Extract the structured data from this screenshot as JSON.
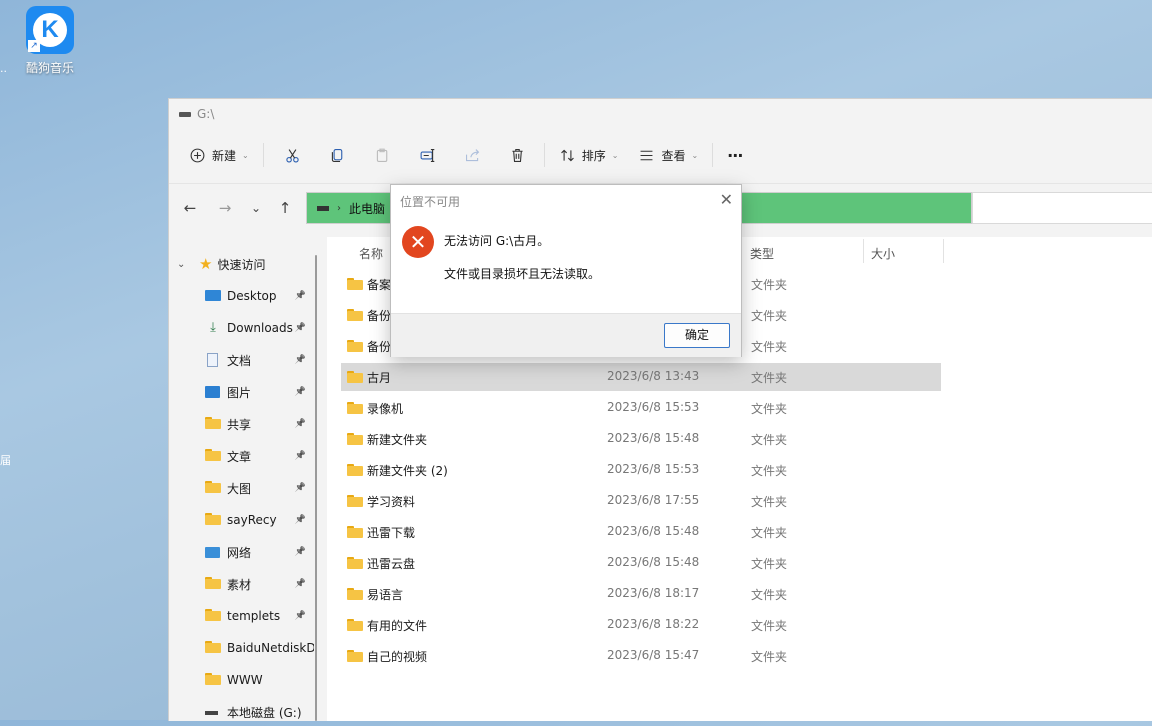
{
  "desktop": {
    "icon_label": "酷狗音乐",
    "icon_letter": "K",
    "edge_dots": "..",
    "edge_char": "届"
  },
  "window": {
    "title": "G:\\",
    "toolbar": {
      "new_label": "新建",
      "sort_label": "排序",
      "view_label": "查看",
      "more_label": "···"
    },
    "nav": {
      "back": "←",
      "forward": "→",
      "recent": "⌄",
      "up": "↑"
    },
    "address": {
      "crumb": "此电脑"
    },
    "sidebar": {
      "quick_access": "快速访问",
      "items": [
        {
          "label": "Desktop",
          "icon": "desktop-icon",
          "pinned": true
        },
        {
          "label": "Downloads",
          "icon": "download-icon",
          "pinned": true
        },
        {
          "label": "文档",
          "icon": "document-icon",
          "pinned": true
        },
        {
          "label": "图片",
          "icon": "picture-icon",
          "pinned": true
        },
        {
          "label": "共享",
          "icon": "folder-icon",
          "pinned": true
        },
        {
          "label": "文章",
          "icon": "folder-icon",
          "pinned": true
        },
        {
          "label": "大图",
          "icon": "folder-icon",
          "pinned": true
        },
        {
          "label": "sayRecy",
          "icon": "folder-icon",
          "pinned": true
        },
        {
          "label": "网络",
          "icon": "network-icon",
          "pinned": true
        },
        {
          "label": "素材",
          "icon": "folder-icon",
          "pinned": true
        },
        {
          "label": "templets",
          "icon": "folder-icon",
          "pinned": true
        },
        {
          "label": "BaiduNetdiskD",
          "icon": "folder-icon",
          "pinned": false
        },
        {
          "label": "WWW",
          "icon": "folder-icon",
          "pinned": false
        },
        {
          "label": "本地磁盘 (G:)",
          "icon": "drive-icon",
          "pinned": false
        }
      ]
    },
    "columns": {
      "name": "名称",
      "type": "类型",
      "size": "大小"
    },
    "files": [
      {
        "name": "备案",
        "date": "",
        "type": "文件夹"
      },
      {
        "name": "备份",
        "date": "",
        "type": "文件夹"
      },
      {
        "name": "备份",
        "date": "",
        "type": "文件夹"
      },
      {
        "name": "古月",
        "date": "2023/6/8 13:43",
        "type": "文件夹",
        "selected": true
      },
      {
        "name": "录像机",
        "date": "2023/6/8 15:53",
        "type": "文件夹"
      },
      {
        "name": "新建文件夹",
        "date": "2023/6/8 15:48",
        "type": "文件夹"
      },
      {
        "name": "新建文件夹 (2)",
        "date": "2023/6/8 15:53",
        "type": "文件夹"
      },
      {
        "name": "学习资料",
        "date": "2023/6/8 17:55",
        "type": "文件夹"
      },
      {
        "name": "迅雷下载",
        "date": "2023/6/8 15:48",
        "type": "文件夹"
      },
      {
        "name": "迅雷云盘",
        "date": "2023/6/8 15:48",
        "type": "文件夹"
      },
      {
        "name": "易语言",
        "date": "2023/6/8 18:17",
        "type": "文件夹"
      },
      {
        "name": "有用的文件",
        "date": "2023/6/8 18:22",
        "type": "文件夹"
      },
      {
        "name": "自己的视频",
        "date": "2023/6/8 15:47",
        "type": "文件夹"
      }
    ]
  },
  "dialog": {
    "title": "位置不可用",
    "close": "✕",
    "error_glyph": "✕",
    "message_1": "无法访问 G:\\古月。",
    "message_2": "文件或目录损坏且无法读取。",
    "ok_label": "确定"
  },
  "colors": {
    "address_progress": "#5ec47a",
    "error_icon": "#e2461f",
    "ok_border": "#3a78c9",
    "folder": "#f6c444"
  }
}
